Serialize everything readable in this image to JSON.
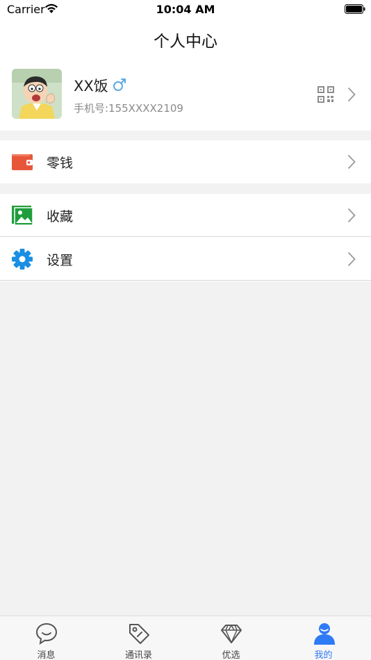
{
  "status_bar": {
    "carrier": "Carrier",
    "time": "10:04 AM"
  },
  "nav": {
    "title": "个人中心"
  },
  "profile": {
    "name": "XX饭",
    "gender_symbol": "♂",
    "phone": "手机号:155XXXX2109"
  },
  "menu": {
    "wallet": "零钱",
    "favorites": "收藏",
    "settings": "设置"
  },
  "tabs": [
    {
      "label": "消息"
    },
    {
      "label": "通讯录"
    },
    {
      "label": "优选"
    },
    {
      "label": "我的"
    }
  ],
  "colors": {
    "accent": "#2f7bf5",
    "wallet": "#e8563a",
    "favorites": "#1f9d3b",
    "settings": "#1a8fe3",
    "gender": "#5aa9e6"
  }
}
